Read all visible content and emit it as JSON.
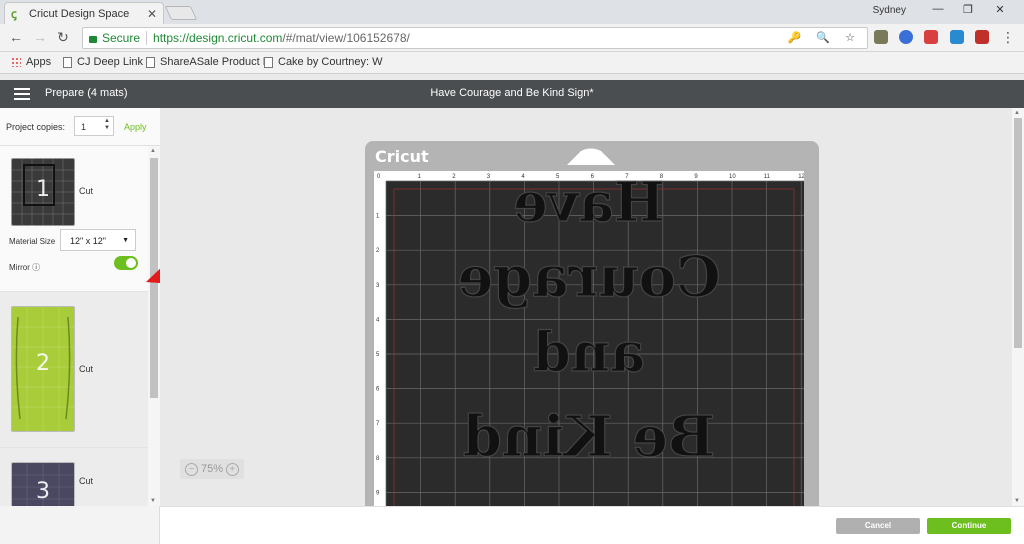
{
  "browser": {
    "tab_title": "Cricut Design Space",
    "tab_close": "✕",
    "profile": "Sydney",
    "window_controls": [
      "—",
      "❐",
      "✕"
    ],
    "nav": {
      "back": "←",
      "forward": "→",
      "reload": "↻"
    },
    "secure_label": "Secure",
    "url_host": "https://design.cricut.com",
    "url_path": "/#/mat/view/106152678/",
    "omnibox_icons": "🔑 🔍 ☆"
  },
  "bookmarks": [
    {
      "label": "Apps",
      "icon": "apps-grid-icon"
    },
    {
      "label": "CJ Deep Link",
      "icon": "page-icon"
    },
    {
      "label": "ShareASale Product L",
      "icon": "page-icon"
    },
    {
      "label": "Cake by Courtney: W",
      "icon": "page-icon"
    }
  ],
  "app": {
    "prepare_label": "Prepare (4 mats)",
    "document_title": "Have Courage and Be Kind Sign*"
  },
  "panel": {
    "copies_label": "Project copies:",
    "copies_value": "1",
    "apply_label": "Apply",
    "mats": [
      {
        "number": "1",
        "mode": "Cut",
        "color": "#3a3a3a"
      },
      {
        "number": "2",
        "mode": "Cut",
        "color": "#a8cc3a"
      },
      {
        "number": "3",
        "mode": "Cut",
        "color": "#4a4860"
      }
    ],
    "material_size_label": "Material Size",
    "material_size_value": "12\" x 12\"",
    "mirror_label": "Mirror ⓘ",
    "mirror_on": true
  },
  "canvas": {
    "logo": "Cricut",
    "ruler_top": [
      "0",
      "1",
      "2",
      "3",
      "4",
      "5",
      "6",
      "7",
      "8",
      "9",
      "10",
      "11",
      "12"
    ],
    "ruler_left": [
      "1",
      "2",
      "3",
      "4",
      "5",
      "6",
      "7",
      "8",
      "9"
    ],
    "design_lines": [
      "Have",
      "Courage",
      "and",
      "Be Kind"
    ],
    "zoom_level": "75%",
    "zoom_minus": "−",
    "zoom_plus": "+"
  },
  "footer": {
    "cancel_label": "Cancel",
    "continue_label": "Continue"
  }
}
